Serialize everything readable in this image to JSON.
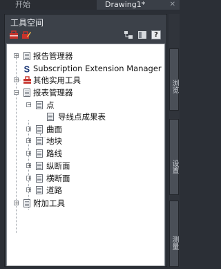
{
  "tabs": [
    {
      "label": "开始"
    },
    {
      "label": "Drawing1*"
    }
  ],
  "panel": {
    "title": "工具空间",
    "tree": [
      {
        "label": "报告管理器"
      },
      {
        "label": "Subscription Extension Manager"
      },
      {
        "label": "其他实用工具"
      },
      {
        "label": "报表管理器"
      },
      {
        "label": "点"
      },
      {
        "label": "导线点成果表"
      },
      {
        "label": "曲面"
      },
      {
        "label": "地块"
      },
      {
        "label": "路线"
      },
      {
        "label": "纵断面"
      },
      {
        "label": "横断面"
      },
      {
        "label": "道路"
      },
      {
        "label": "附加工具"
      }
    ]
  },
  "side_tabs": [
    {
      "label": "浏览"
    },
    {
      "label": "设置"
    },
    {
      "label": "测量"
    }
  ]
}
